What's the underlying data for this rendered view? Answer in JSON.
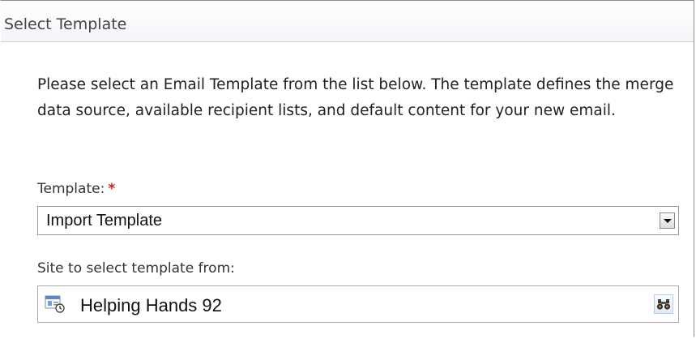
{
  "header": {
    "title": "Select Template"
  },
  "intro_text": "Please select an Email Template from the list below. The template defines the merge data source, available recipient lists, and default content for your new email.",
  "template_field": {
    "label": "Template:",
    "required_mark": "*",
    "selected_value": "Import Template"
  },
  "site_field": {
    "label": "Site to select template from:",
    "value": "Helping Hands 92",
    "icon": "site-page-icon",
    "browse_icon": "binoculars-icon"
  },
  "colors": {
    "required": "#e0191b",
    "border": "#9a9a9a"
  }
}
